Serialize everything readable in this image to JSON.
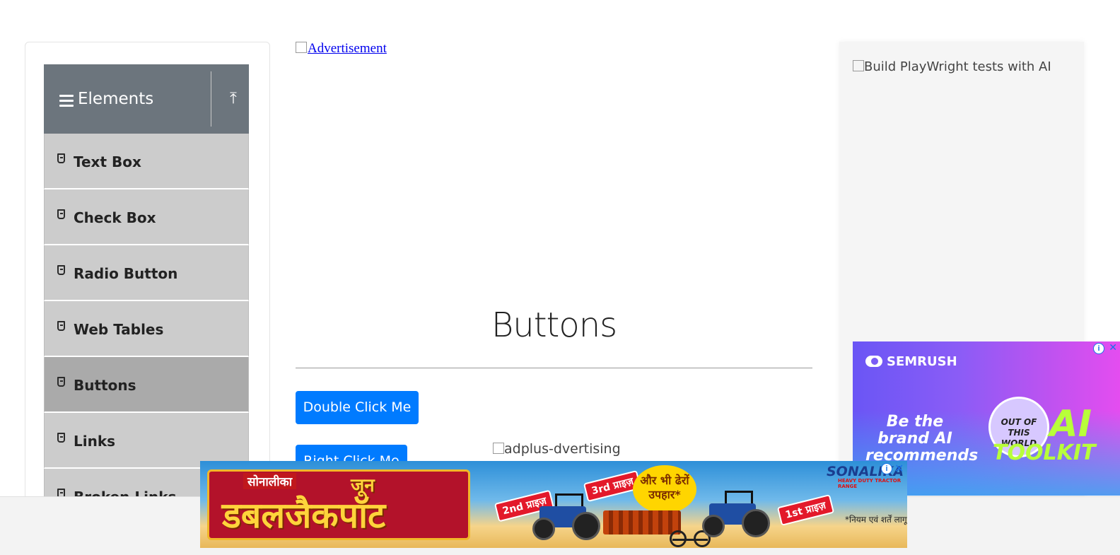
{
  "sidebar": {
    "group_title": "Elements",
    "items": [
      {
        "label": "Text Box",
        "active": false
      },
      {
        "label": "Check Box",
        "active": false
      },
      {
        "label": "Radio Button",
        "active": false
      },
      {
        "label": "Web Tables",
        "active": false
      },
      {
        "label": "Buttons",
        "active": true
      },
      {
        "label": "Links",
        "active": false
      },
      {
        "label": "Broken Links - Images",
        "active": false
      }
    ]
  },
  "top_ad": {
    "alt": "Advertisement"
  },
  "main": {
    "title": "Buttons",
    "double_click_label": "Double Click Me",
    "right_click_label": "Right Click Me",
    "inline_ad_alt": "adplus-dvertising"
  },
  "right_ad": {
    "alt": "Build PlayWright tests with AI",
    "semrush": {
      "brand": "SEMRUSH",
      "tagline": "Be the brand AI recommends",
      "badge": "OUT OF THIS WORLD",
      "headline_ai": "AI",
      "headline_toolkit": "TOOLKIT"
    }
  },
  "bottom_ad": {
    "brand": "SONALIKA",
    "brand_sub": "HEAVY DUTY TRACTOR RANGE",
    "small_top": "सोनालीका",
    "june": "जून",
    "headline": "डबलजैकपॉट",
    "prize_1": "1st प्राइज़",
    "prize_2": "2nd प्राइज़",
    "prize_3": "3rd प्राइज़",
    "gift": "और भी ढेरों उपहार*",
    "terms": "*नियम एवं शर्तें लागू"
  },
  "colors": {
    "primary_button": "#007bff",
    "sidebar_header": "#6c757d",
    "menu_item": "#cccccc",
    "menu_item_active": "#aaaaaa"
  }
}
